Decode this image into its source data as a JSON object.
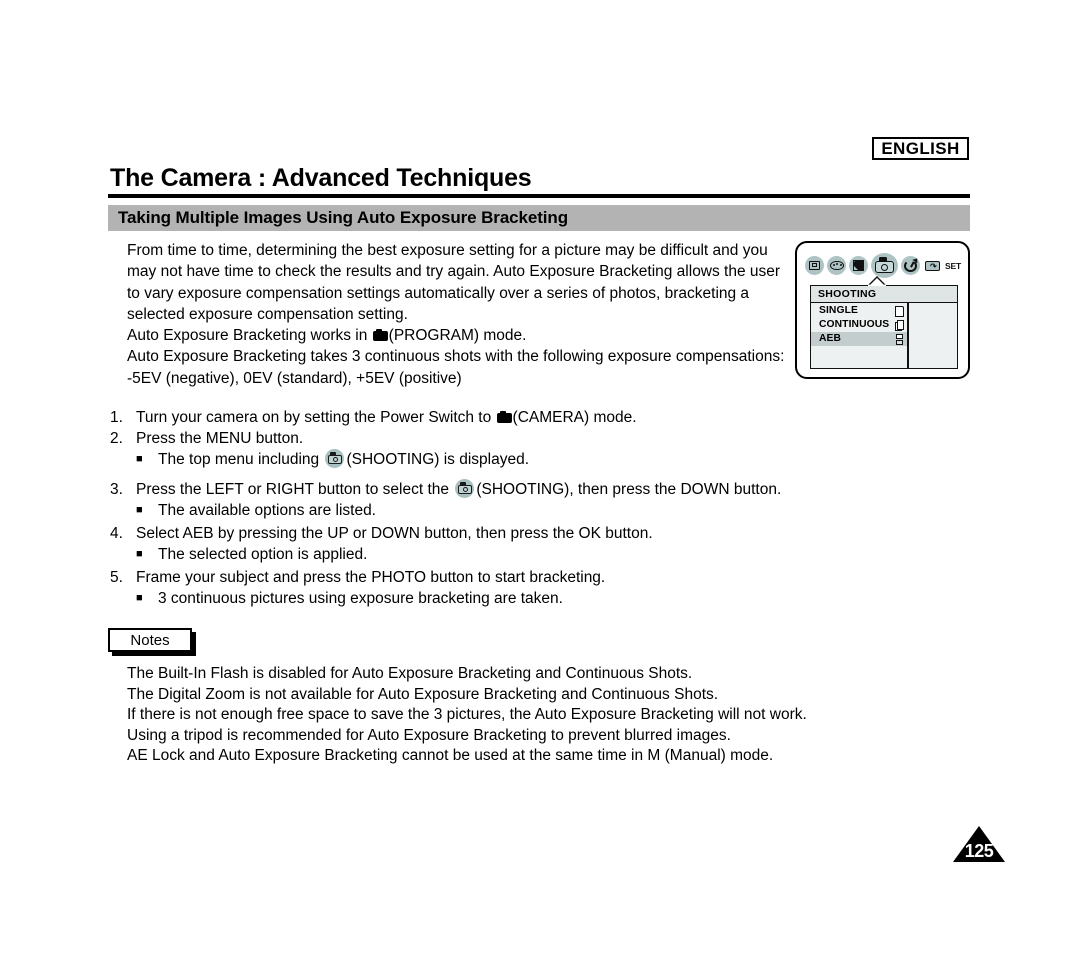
{
  "header": {
    "language_badge": "ENGLISH",
    "page_title": "The Camera : Advanced Techniques",
    "section_title": "Taking Multiple Images Using Auto Exposure Bracketing"
  },
  "intro": {
    "para1": "From time to time, determining the best exposure setting for a picture may be difficult and you may not have time to check the results and try again. Auto Exposure Bracketing allows the user to vary exposure compensation settings automatically over a series of photos, bracketing a selected exposure compensation setting.",
    "para2_before": "Auto Exposure Bracketing works in ",
    "para2_after": "(PROGRAM) mode.",
    "para3": "Auto Exposure Bracketing takes 3 continuous shots with the following exposure compensations:",
    "para4": "-5EV (negative), 0EV (standard), +5EV (positive)"
  },
  "steps": [
    {
      "num": "1.",
      "text_before": "Turn your camera on by setting the Power Switch to ",
      "text_after": "(CAMERA) mode.",
      "icon": "camera-solid-icon"
    },
    {
      "num": "2.",
      "text": "Press the MENU button.",
      "sub_before": "The top menu including ",
      "sub_after": "(SHOOTING) is displayed.",
      "sub_icon": "shooting-circle-icon",
      "bullet": "■"
    },
    {
      "num": "3.",
      "text_before": "Press the LEFT or RIGHT button to select the ",
      "text_after": "(SHOOTING), then press the DOWN button.",
      "icon": "shooting-circle-icon",
      "sub": "The available options are listed.",
      "bullet": "■"
    },
    {
      "num": "4.",
      "text": "Select AEB by pressing the UP or DOWN button, then press the OK button.",
      "sub": "The selected option is applied.",
      "bullet": "■"
    },
    {
      "num": "5.",
      "text": "Frame your subject and press the PHOTO button to start bracketing.",
      "sub": "3 continuous pictures using exposure bracketing are taken.",
      "bullet": "■"
    }
  ],
  "notes": {
    "label": "Notes",
    "items": [
      "The Built-In Flash is disabled for Auto Exposure Bracketing and Continuous Shots.",
      "The Digital Zoom is not available for Auto Exposure Bracketing and Continuous Shots.",
      "If there is not enough free space to save the 3 pictures, the Auto Exposure Bracketing will not work.",
      "Using a tripod is recommended for Auto Exposure Bracketing to prevent blurred images.",
      "AE Lock and Auto Exposure Bracketing cannot be used at the same time in M (Manual) mode."
    ]
  },
  "lcd": {
    "icons": [
      "display-icon",
      "white-balance-palette-icon",
      "exposure-icon",
      "camera-shooting-icon",
      "self-timer-icon",
      "playback-back-icon",
      "set-icon"
    ],
    "set_label": "SET",
    "menu_title": "SHOOTING",
    "options": [
      {
        "label": "SINGLE",
        "selected": false,
        "glyph": "single-sheet-icon"
      },
      {
        "label": "CONTINUOUS",
        "selected": false,
        "glyph": "stacked-sheets-icon"
      },
      {
        "label": "AEB",
        "selected": true,
        "glyph": "split-sheet-icon"
      }
    ]
  },
  "footer": {
    "page_number": "125"
  },
  "colors": {
    "section_bar": "#b3b3b3",
    "icon_circle": "#aec4c4",
    "menu_bg": "#eef1f1",
    "menu_title_bg": "#dfe4e4",
    "selected_row": "#c3cdcd"
  }
}
